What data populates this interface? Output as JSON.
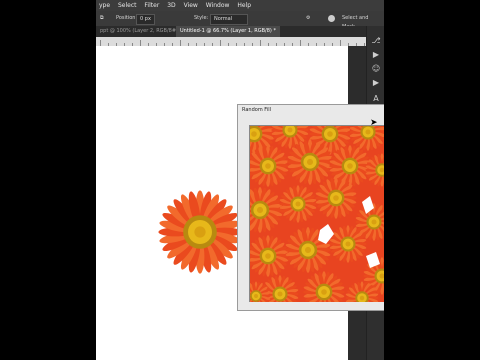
{
  "menu": [
    "ype",
    "Select",
    "Filter",
    "3D",
    "View",
    "Window",
    "Help"
  ],
  "options": {
    "position_label": "Position:",
    "position_value": "0 px",
    "style_label": "Style:",
    "style_value": "Normal",
    "select_mask": "Select and Mask..."
  },
  "tabs": [
    "ppt @ 100% (Layer 2, RGB/8#)",
    "Untitled-1 @ 66.7% (Layer 1, RGB/8) *"
  ],
  "dialog": {
    "title": "Random Fill"
  },
  "colors": {
    "petal": "#ea4a1e",
    "petal_light": "#f26a2c",
    "center": "#e7b81a",
    "center_dark": "#b88a10"
  }
}
